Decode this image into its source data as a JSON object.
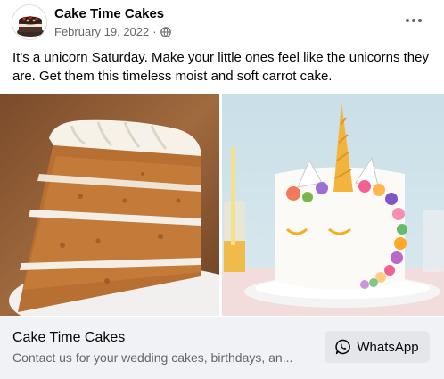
{
  "post": {
    "page_name": "Cake Time Cakes",
    "date": "February 19, 2022",
    "separator": "·",
    "privacy_icon": "globe-icon",
    "more_icon": "more-horizontal-icon",
    "text": "It's a unicorn Saturday. Make your little ones feel like the unicorns they are.  Get them this timeless moist and soft carrot cake."
  },
  "images": [
    {
      "subject": "carrot-cake-slice"
    },
    {
      "subject": "unicorn-cake"
    }
  ],
  "link_card": {
    "title": "Cake Time Cakes",
    "description": "Contact us for your wedding cakes, birthdays, an...",
    "button_label": "WhatsApp",
    "button_icon": "whatsapp-icon"
  },
  "colors": {
    "card_bg": "#f0f2f5",
    "button_bg": "#e4e6eb",
    "secondary_text": "#65676b"
  }
}
